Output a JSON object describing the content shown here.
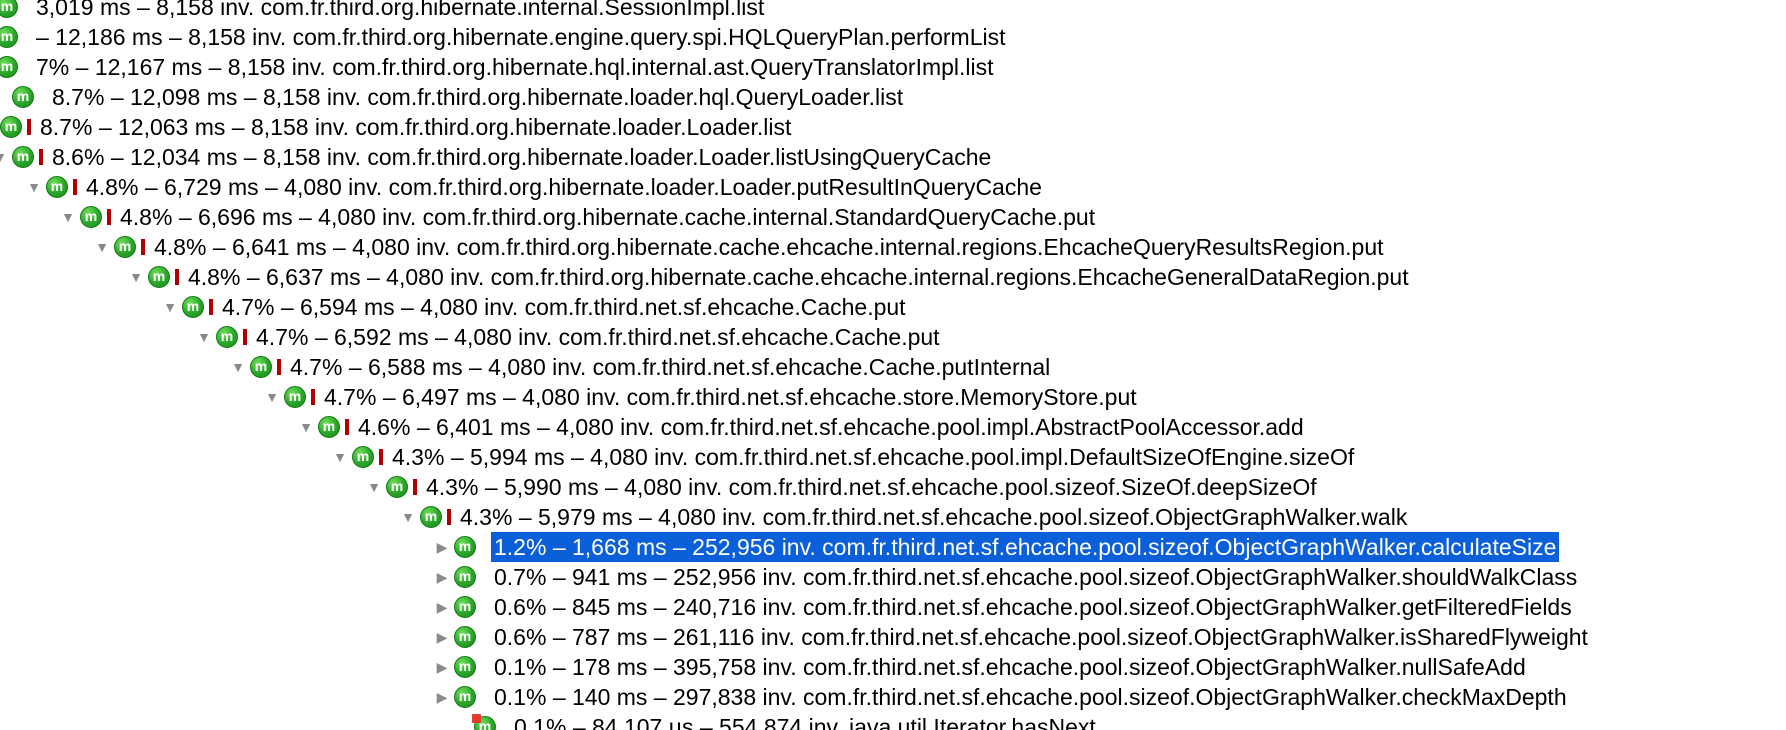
{
  "call_tree": {
    "rows": [
      {
        "text": "3,019 ms – 8,158 inv. com.fr.third.org.hibernate.internal.SessionImpl.list",
        "toggle": "",
        "bar": false,
        "selected": false
      },
      {
        "text": "– 12,186 ms – 8,158 inv. com.fr.third.org.hibernate.engine.query.spi.HQLQueryPlan.performList",
        "toggle": "",
        "bar": false,
        "selected": false
      },
      {
        "text": "7% – 12,167 ms – 8,158 inv. com.fr.third.org.hibernate.hql.internal.ast.QueryTranslatorImpl.list",
        "toggle": "",
        "bar": false,
        "selected": false
      },
      {
        "text": "8.7% – 12,098 ms – 8,158 inv. com.fr.third.org.hibernate.loader.hql.QueryLoader.list",
        "toggle": "",
        "bar": false,
        "selected": false
      },
      {
        "text": "8.7% – 12,063 ms – 8,158 inv. com.fr.third.org.hibernate.loader.Loader.list",
        "toggle": "",
        "bar": true,
        "selected": false
      },
      {
        "text": "8.6% – 12,034 ms – 8,158 inv. com.fr.third.org.hibernate.loader.Loader.listUsingQueryCache",
        "toggle": "▼",
        "bar": true,
        "selected": false
      },
      {
        "text": "4.8% – 6,729 ms – 4,080 inv. com.fr.third.org.hibernate.loader.Loader.putResultInQueryCache",
        "toggle": "▼",
        "bar": true,
        "selected": false
      },
      {
        "text": "4.8% – 6,696 ms – 4,080 inv. com.fr.third.org.hibernate.cache.internal.StandardQueryCache.put",
        "toggle": "▼",
        "bar": true,
        "selected": false
      },
      {
        "text": "4.8% – 6,641 ms – 4,080 inv. com.fr.third.org.hibernate.cache.ehcache.internal.regions.EhcacheQueryResultsRegion.put",
        "toggle": "▼",
        "bar": true,
        "selected": false
      },
      {
        "text": "4.8% – 6,637 ms – 4,080 inv. com.fr.third.org.hibernate.cache.ehcache.internal.regions.EhcacheGeneralDataRegion.put",
        "toggle": "▼",
        "bar": true,
        "selected": false
      },
      {
        "text": "4.7% – 6,594 ms – 4,080 inv. com.fr.third.net.sf.ehcache.Cache.put",
        "toggle": "▼",
        "bar": true,
        "selected": false
      },
      {
        "text": "4.7% – 6,592 ms – 4,080 inv. com.fr.third.net.sf.ehcache.Cache.put",
        "toggle": "▼",
        "bar": true,
        "selected": false
      },
      {
        "text": "4.7% – 6,588 ms – 4,080 inv. com.fr.third.net.sf.ehcache.Cache.putInternal",
        "toggle": "▼",
        "bar": true,
        "selected": false
      },
      {
        "text": "4.7% – 6,497 ms – 4,080 inv. com.fr.third.net.sf.ehcache.store.MemoryStore.put",
        "toggle": "▼",
        "bar": true,
        "selected": false
      },
      {
        "text": "4.6% – 6,401 ms – 4,080 inv. com.fr.third.net.sf.ehcache.pool.impl.AbstractPoolAccessor.add",
        "toggle": "▼",
        "bar": true,
        "selected": false
      },
      {
        "text": "4.3% – 5,994 ms – 4,080 inv. com.fr.third.net.sf.ehcache.pool.impl.DefaultSizeOfEngine.sizeOf",
        "toggle": "▼",
        "bar": true,
        "selected": false
      },
      {
        "text": "4.3% – 5,990 ms – 4,080 inv. com.fr.third.net.sf.ehcache.pool.sizeof.SizeOf.deepSizeOf",
        "toggle": "▼",
        "bar": true,
        "selected": false
      },
      {
        "text": "4.3% – 5,979 ms – 4,080 inv. com.fr.third.net.sf.ehcache.pool.sizeof.ObjectGraphWalker.walk",
        "toggle": "▼",
        "bar": true,
        "selected": false
      },
      {
        "text": "1.2% – 1,668 ms – 252,956 inv. com.fr.third.net.sf.ehcache.pool.sizeof.ObjectGraphWalker.calculateSize",
        "toggle": "▶",
        "bar": false,
        "selected": true
      },
      {
        "text": "0.7% – 941 ms – 252,956 inv. com.fr.third.net.sf.ehcache.pool.sizeof.ObjectGraphWalker.shouldWalkClass",
        "toggle": "▶",
        "bar": false,
        "selected": false
      },
      {
        "text": "0.6% – 845 ms – 240,716 inv. com.fr.third.net.sf.ehcache.pool.sizeof.ObjectGraphWalker.getFilteredFields",
        "toggle": "▶",
        "bar": false,
        "selected": false
      },
      {
        "text": "0.6% – 787 ms – 261,116 inv. com.fr.third.net.sf.ehcache.pool.sizeof.ObjectGraphWalker.isSharedFlyweight",
        "toggle": "▶",
        "bar": false,
        "selected": false
      },
      {
        "text": "0.1% – 178 ms – 395,758 inv. com.fr.third.net.sf.ehcache.pool.sizeof.ObjectGraphWalker.nullSafeAdd",
        "toggle": "▶",
        "bar": false,
        "selected": false
      },
      {
        "text": "0.1% – 140 ms – 297,838 inv. com.fr.third.net.sf.ehcache.pool.sizeof.ObjectGraphWalker.checkMaxDepth",
        "toggle": "▶",
        "bar": false,
        "selected": false
      },
      {
        "text": "0.1% – 84,107 µs – 554,874 inv. java.util.Iterator.hasNext",
        "toggle": "",
        "bar": false,
        "selected": false,
        "flag": true
      }
    ],
    "icon_name": "method-icon",
    "icon_glyph": "m",
    "hot_bar_color": "#b00000",
    "selection_color": "#0b5fd9"
  }
}
